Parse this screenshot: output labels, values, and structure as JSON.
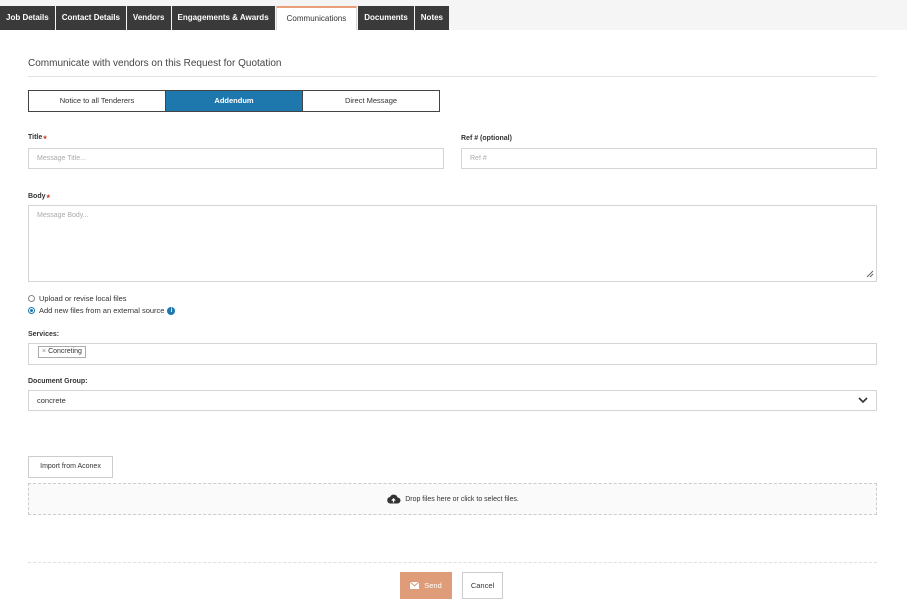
{
  "tabs": [
    {
      "label": "Job Details"
    },
    {
      "label": "Contact Details"
    },
    {
      "label": "Vendors"
    },
    {
      "label": "Engagements & Awards"
    },
    {
      "label": "Communications"
    },
    {
      "label": "Documents"
    },
    {
      "label": "Notes"
    }
  ],
  "heading": "Communicate with vendors on this Request for Quotation",
  "segments": [
    {
      "label": "Notice to all Tenderers"
    },
    {
      "label": "Addendum"
    },
    {
      "label": "Direct Message"
    }
  ],
  "form": {
    "title_label": "Title",
    "title_required": "*",
    "title_placeholder": "Message Title...",
    "ref_label": "Ref # (optional)",
    "ref_placeholder": "Ref #",
    "body_label": "Body",
    "body_required": "*",
    "body_placeholder": "Message Body..."
  },
  "upload_options": [
    {
      "label": "Upload or revise local files",
      "selected": false
    },
    {
      "label": "Add new files from an external source",
      "selected": true
    }
  ],
  "services": {
    "label": "Services:",
    "tags": [
      {
        "remove": "×",
        "label": "Concreting"
      }
    ]
  },
  "document_group": {
    "label": "Document Group:",
    "value": "concrete"
  },
  "import_button": "Import from Aconex",
  "dropzone_text": "Drop files here or click to select files.",
  "send_button": "Send",
  "cancel_button": "Cancel",
  "colors": {
    "accent": "#1e78ad",
    "send": "#de9d78",
    "tab_dark": "#3a3a3a",
    "required": "#c0392b"
  }
}
